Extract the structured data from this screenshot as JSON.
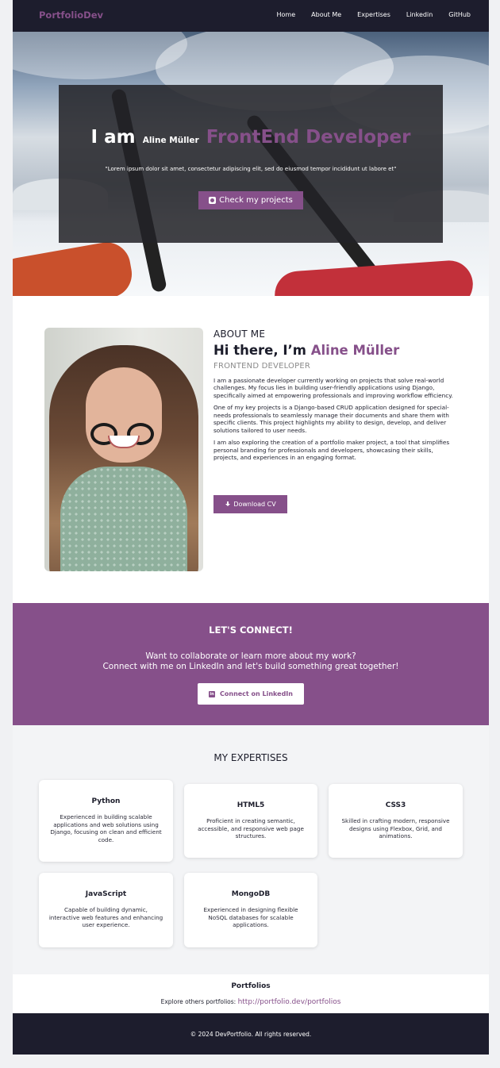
{
  "nav": {
    "brand": "PortfolioDev",
    "links": [
      "Home",
      "About Me",
      "Expertises",
      "Linkedin",
      "GitHub"
    ]
  },
  "hero": {
    "iam": "I am",
    "name": "Aline Müller",
    "role": "FrontEnd Developer",
    "quote": "\"Lorem ipsum dolor sit amet, consectetur adipiscing elit, sed do eiusmod tempor incididunt ut labore et\"",
    "button_label": "Check my projects"
  },
  "about": {
    "kicker": "ABOUT ME",
    "greeting": "Hi there, I’m",
    "name": "Aline Müller",
    "role": "FRONTEND DEVELOPER",
    "paragraphs": [
      "I am a passionate developer currently working on projects that solve real-world challenges. My focus lies in building user-friendly applications using Django, specifically aimed at empowering professionals and improving workflow efficiency.",
      "One of my key projects is a Django-based CRUD application designed for special-needs professionals to seamlessly manage their documents and share them with specific clients. This project highlights my ability to design, develop, and deliver solutions tailored to user needs.",
      "I am also exploring the creation of a portfolio maker project, a tool that simplifies personal branding for professionals and developers, showcasing their skills, projects, and experiences in an engaging format."
    ],
    "download_label": "Download CV"
  },
  "connect": {
    "title": "LET'S CONNECT!",
    "line1": "Want to collaborate or learn more about my work?",
    "line2": "Connect with me on LinkedIn and let's build something great together!",
    "button_label": "Connect on LinkedIn"
  },
  "expertises": {
    "title": "MY EXPERTISES",
    "cards": [
      {
        "title": "Python",
        "desc": "Experienced in building scalable applications and web solutions using Django, focusing on clean and efficient code."
      },
      {
        "title": "HTML5",
        "desc": "Proficient in creating semantic, accessible, and responsive web page structures."
      },
      {
        "title": "CSS3",
        "desc": "Skilled in crafting modern, responsive designs using Flexbox, Grid, and animations."
      },
      {
        "title": "JavaScript",
        "desc": "Capable of building dynamic, interactive web features and enhancing user experience."
      },
      {
        "title": "MongoDB",
        "desc": "Experienced in designing flexible NoSQL databases for scalable applications."
      }
    ]
  },
  "portfolios": {
    "title": "Portfolios",
    "text": "Explore others portfolios:",
    "link": "http://portfolio.dev/portfolios"
  },
  "footer": {
    "text": "© 2024 DevPortfolio. All rights reserved."
  },
  "colors": {
    "accent": "#86508a",
    "dark": "#1d1d2d"
  }
}
